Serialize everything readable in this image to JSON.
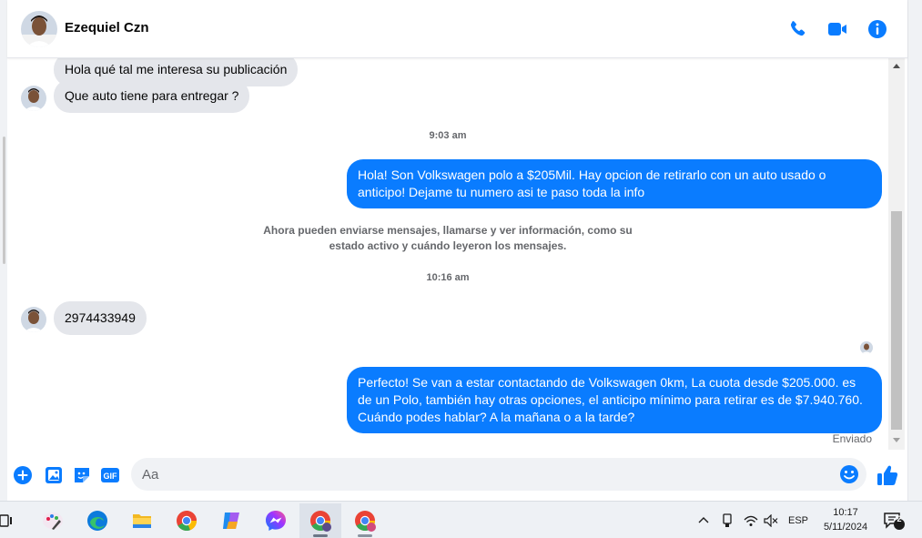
{
  "header": {
    "contact_name": "Ezequiel Czn",
    "icons": [
      "phone-icon",
      "video-camera-icon",
      "info-icon"
    ],
    "accent": "#0a7cff"
  },
  "messages": {
    "incoming_1": "Hola qué tal me interesa su publicación",
    "incoming_2": "Que auto tiene para entregar ?",
    "time_1": "9:03 am",
    "outgoing_1": "Hola! Son Volkswagen polo a $205Mil. Hay opcion de retirarlo con un auto usado o anticipo! Dejame tu numero asi te paso toda la info",
    "notice": "Ahora pueden enviarse mensajes, llamarse y ver información, como su estado activo y cuándo leyeron los mensajes.",
    "time_2": "10:16 am",
    "incoming_3": "2974433949",
    "outgoing_2": "Perfecto!  Se van a estar contactando de Volkswagen 0km, La cuota desde $205.000. es de un Polo, también hay otras opciones, el anticipo mínimo para retirar es de $7.940.760. Cuándo podes hablar? A la mañana o a la tarde?",
    "sent_status": "Enviado"
  },
  "composer": {
    "placeholder": "Aa",
    "value": "",
    "gif_label": "GIF",
    "icons": [
      "plus-circle-icon",
      "photo-icon",
      "sticker-icon",
      "gif-icon",
      "emoji-icon",
      "thumbs-up-icon"
    ]
  },
  "taskbar": {
    "apps": [
      "task-view-icon",
      "paint-icon",
      "edge-icon",
      "file-explorer-icon",
      "chrome-icon",
      "copilot-icon",
      "messenger-icon",
      "chrome-profile-icon",
      "chrome-profile-icon"
    ],
    "language": "ESP",
    "time": "10:17",
    "date": "5/11/2024",
    "notification_count": "2"
  }
}
